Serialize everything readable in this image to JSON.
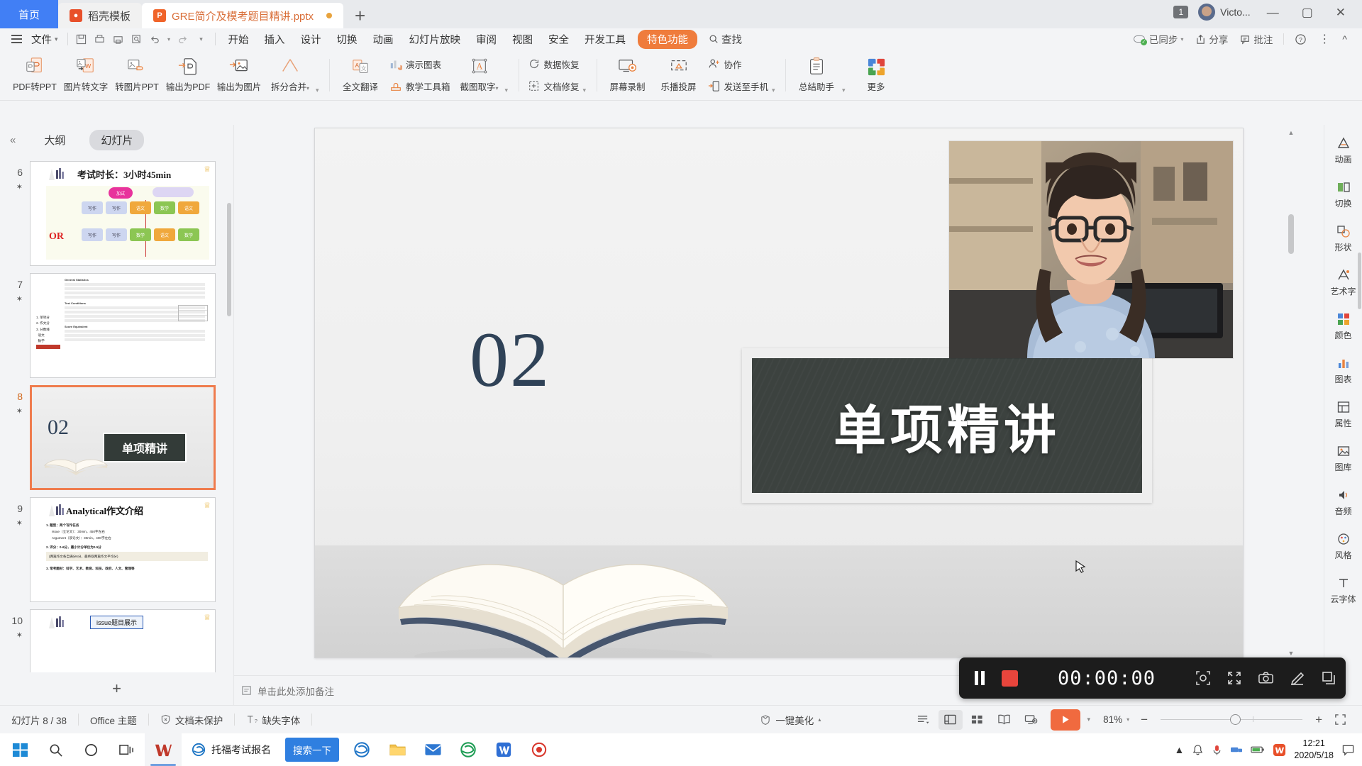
{
  "tabbar": {
    "home_tab": "首页",
    "tabs": [
      {
        "label": "稻壳模板",
        "icon": "docer-icon",
        "active": false
      },
      {
        "label": "GRE简介及模考题目精讲.pptx",
        "icon": "ppt-file-icon",
        "active": true
      }
    ],
    "new_tab": "+",
    "notification_count": "1",
    "user_name": "Victo...",
    "window_minimize": "—",
    "window_maximize": "▢",
    "window_close": "✕"
  },
  "menubar": {
    "file": "文件",
    "quick_access": [
      "save-icon",
      "print-preview-icon",
      "print-icon",
      "find-icon",
      "undo-icon",
      "redo-icon",
      "customize-icon"
    ],
    "items": [
      "开始",
      "插入",
      "设计",
      "切换",
      "动画",
      "幻灯片放映",
      "审阅",
      "视图",
      "安全",
      "开发工具"
    ],
    "highlight_item": "特色功能",
    "search": "查找",
    "right": {
      "sync": "已同步",
      "share": "分享",
      "comment": "批注",
      "help": "?",
      "more": "⋮",
      "collapse": "^"
    }
  },
  "ribbon": {
    "groups": [
      {
        "buttons": [
          {
            "label": "PDF转PPT",
            "icon": "pdf-to-ppt-icon"
          },
          {
            "label": "图片转文字",
            "icon": "image-to-text-icon"
          },
          {
            "label": "转图片PPT",
            "icon": "to-image-ppt-icon"
          },
          {
            "label": "输出为PDF",
            "icon": "export-pdf-icon"
          },
          {
            "label": "输出为图片",
            "icon": "export-image-icon"
          },
          {
            "label": "拆分合并",
            "icon": "split-merge-icon",
            "dropdown": true
          }
        ]
      },
      {
        "buttons": [
          {
            "label": "全文翻译",
            "icon": "translate-icon"
          },
          {
            "label": "演示图表",
            "icon": "chart-icon"
          },
          {
            "label": "教学工具箱",
            "icon": "teaching-toolbox-icon"
          },
          {
            "label": "截图取字",
            "icon": "ocr-icon",
            "dropdown": true
          }
        ]
      },
      {
        "buttons": [
          {
            "label": "数据恢复",
            "icon": "data-recovery-icon"
          },
          {
            "label": "文档修复",
            "icon": "document-repair-icon"
          }
        ]
      },
      {
        "buttons": [
          {
            "label": "屏幕录制",
            "icon": "screen-record-icon"
          },
          {
            "label": "乐播投屏",
            "icon": "cast-screen-icon"
          },
          {
            "label": "协作",
            "icon": "collaborate-icon"
          },
          {
            "label": "发送至手机",
            "icon": "send-to-phone-icon"
          }
        ]
      },
      {
        "buttons": [
          {
            "label": "总结助手",
            "icon": "summary-assistant-icon"
          },
          {
            "label": "更多",
            "icon": "more-apps-icon"
          }
        ]
      }
    ]
  },
  "left_panel": {
    "collapse_icon": "collapse-left-icon",
    "tab_outline": "大纲",
    "tab_slides": "幻灯片",
    "add_slide": "+",
    "thumbnails": [
      {
        "number": "6",
        "title": "考试时长：3小时45min",
        "or_label": "OR",
        "selected": false
      },
      {
        "number": "7",
        "title": "",
        "selected": false
      },
      {
        "number": "8",
        "number_text": "02",
        "board_text": "单项精讲",
        "selected": true
      },
      {
        "number": "9",
        "title": "Analytical作文介绍",
        "selected": false
      },
      {
        "number": "10",
        "title": "issue题目展示",
        "selected": false
      }
    ]
  },
  "slide": {
    "section_number": "02",
    "board_text": "单项精讲",
    "webcam_label": "presenter-webcam"
  },
  "notes": {
    "icon": "notes-icon",
    "placeholder": "单击此处添加备注"
  },
  "right_rail": [
    {
      "label": "动画",
      "icon": "animation-icon"
    },
    {
      "label": "切换",
      "icon": "transition-icon"
    },
    {
      "label": "形状",
      "icon": "shape-icon"
    },
    {
      "label": "艺术字",
      "icon": "wordart-icon"
    },
    {
      "label": "颜色",
      "icon": "color-icon"
    },
    {
      "label": "图表",
      "icon": "chart-panel-icon"
    },
    {
      "label": "属性",
      "icon": "properties-icon"
    },
    {
      "label": "图库",
      "icon": "gallery-icon"
    },
    {
      "label": "音频",
      "icon": "audio-icon"
    },
    {
      "label": "风格",
      "icon": "style-icon"
    },
    {
      "label": "云字体",
      "icon": "cloud-font-icon"
    }
  ],
  "record_toolbar": {
    "pause": "pause-icon",
    "stop": "stop-icon",
    "time": "00:00:00",
    "tools": [
      "focus-icon",
      "resize-icon",
      "camera-icon",
      "pen-icon",
      "window-icon"
    ]
  },
  "statusbar": {
    "slide_counter": "幻灯片 8 / 38",
    "theme": "Office 主题",
    "protection": "文档未保护",
    "font_missing": "缺失字体",
    "beautify": "一键美化",
    "views": [
      "list-view-icon",
      "normal-view-icon",
      "sorter-view-icon",
      "reading-view-icon",
      "presenter-view-icon"
    ],
    "play": "play-icon",
    "zoom": "81%",
    "zoom_out": "−",
    "zoom_in": "+",
    "fit": "fit-screen-icon"
  },
  "taskbar": {
    "start": "start-icon",
    "search": "search-icon",
    "cortana": "cortana-icon",
    "taskview": "task-view-icon",
    "apps": [
      "wps-icon",
      "edge-icon"
    ],
    "app_text": "托福考试报名",
    "search_chip": "搜索一下",
    "more_apps": [
      "edge-blue-icon",
      "explorer-icon",
      "mail-icon",
      "edge-green-icon",
      "wps-blue-icon",
      "record-red-icon"
    ],
    "tray": [
      "chevron-up-icon",
      "notification-icon",
      "mic-icon",
      "network-icon",
      "battery-icon",
      "wps-tray-icon"
    ],
    "time": "12:21",
    "date": "2020/5/18",
    "action_center": "action-center-icon"
  },
  "colors": {
    "accent_orange": "#ef7c3c",
    "tab_blue": "#417ff5",
    "select_orange": "#ef7c4e",
    "board_dark": "#3c423f",
    "number_navy": "#2f4257"
  }
}
